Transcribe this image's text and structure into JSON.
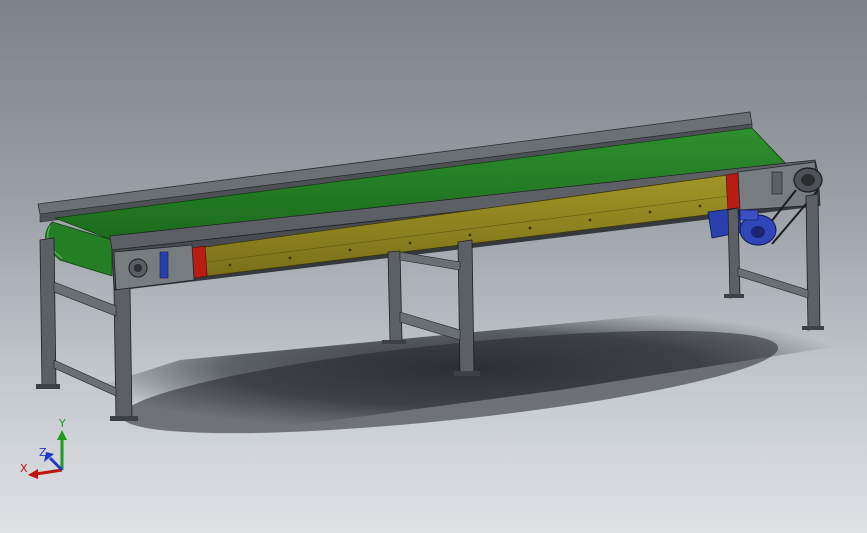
{
  "viewport": {
    "background_top": "#7d8288",
    "background_bottom": "#dfe2e5"
  },
  "model": {
    "belt_color": "#1f7a1f",
    "frame_color": "#54585c",
    "guard_color": "#8f8420",
    "endplate_color": "#b81c12",
    "motor_color": "#2a3fae"
  },
  "triad": {
    "x_label": "X",
    "y_label": "Y",
    "z_label": "Z",
    "x_color": "#c0140c",
    "y_color": "#1f9a1f",
    "z_color": "#2236c8"
  }
}
